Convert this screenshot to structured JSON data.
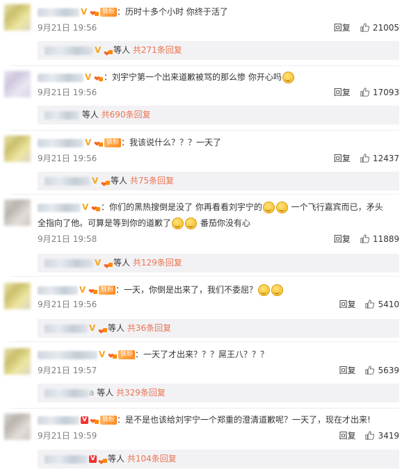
{
  "comments": [
    {
      "text": "：历时十多个小时 你终于活了",
      "time": "9月21日 19:56",
      "reply_label": "回复",
      "likes": "21005",
      "sub_text": "等人",
      "sub_link": "共271条回复",
      "fan_badge": "铁粉"
    },
    {
      "text": "：刘宇宁第一个出来道歉被骂的那么惨 你开心吗",
      "time": "9月21日 19:56",
      "reply_label": "回复",
      "likes": "17093",
      "sub_text": "等人",
      "sub_link": "共690条回复"
    },
    {
      "text": "：我该说什么？？？一天了",
      "time": "9月21日 19:56",
      "reply_label": "回复",
      "likes": "12437",
      "sub_text": "等人",
      "sub_link": "共75条回复",
      "fan_badge": "铁粉"
    },
    {
      "text_a": "：你们的黑热搜倒是没了 你再看看刘宇宁的",
      "text_b": "一个飞行嘉宾而已，矛头",
      "text_c": "全指向了他。可算是等到你的道歉了",
      "text_d": "番茄你没有心",
      "time": "9月21日 19:58",
      "reply_label": "回复",
      "likes": "11889",
      "sub_text": "等人",
      "sub_link": "共129条回复"
    },
    {
      "text": "：一天，你倒是出来了，我们不委屈？",
      "time": "9月21日 19:56",
      "reply_label": "回复",
      "likes": "5410",
      "sub_text": "等人",
      "sub_link": "共36条回复",
      "fan_badge": "铁粉"
    },
    {
      "text": "：一天了才出来？？？屌王八？？？",
      "time": "9月21日 19:57",
      "reply_label": "回复",
      "likes": "5639",
      "sub_text": "等人",
      "sub_link": "共329条回复",
      "fan_badge": "铁粉",
      "sub_prefix": "a"
    },
    {
      "text": "：是不是也该给刘宇宁一个郑重的澄清道歉呢？一天了，现在才出来!",
      "time": "9月21日 19:59",
      "reply_label": "回复",
      "likes": "3419",
      "sub_text": "等人",
      "sub_link": "共104条回复",
      "fan_badge": "铁粉"
    }
  ],
  "icons": {
    "like": "thumbs-up-icon",
    "verified": "v-badge-icon",
    "emoji": "smile-emoji-icon"
  },
  "colors": {
    "link": "#eb7350",
    "badge_gold": "#f5a623",
    "fan_badge": "#ff8a1e"
  }
}
